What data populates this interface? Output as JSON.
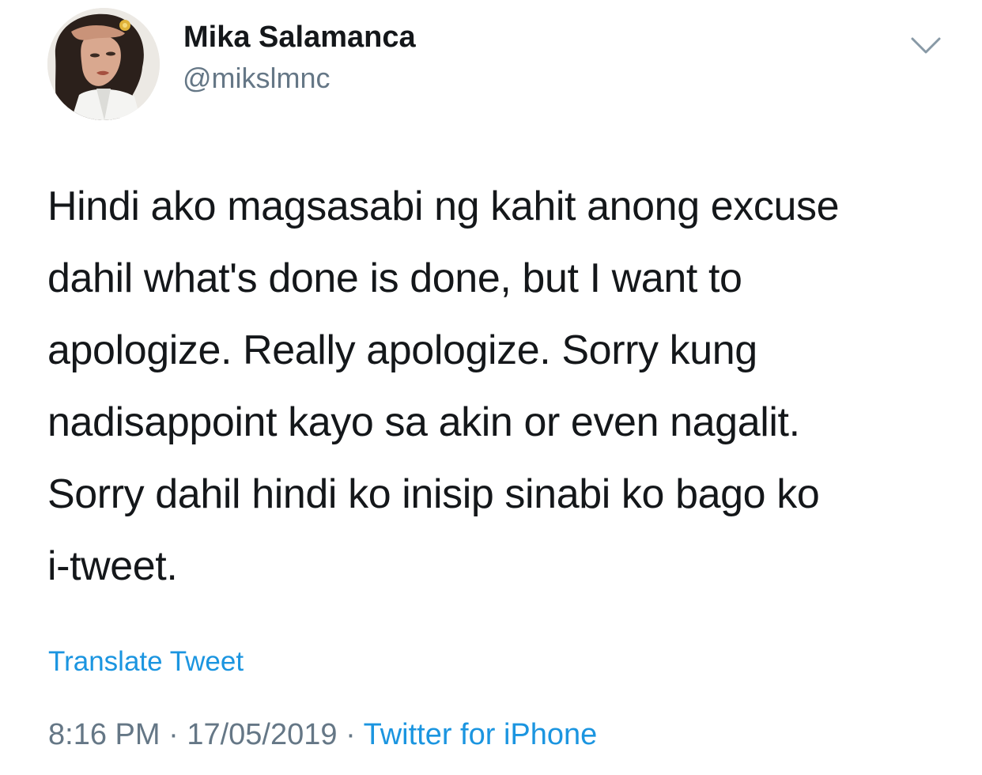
{
  "tweet": {
    "author": {
      "display_name": "Mika Salamanca",
      "handle": "@mikslmnc"
    },
    "text_lines": [
      "Hindi ako magsasabi ng kahit anong excuse",
      "dahil what's done is done, but I want to",
      "apologize. Really apologize. Sorry kung",
      "nadisappoint kayo sa akin or even nagalit.",
      "Sorry dahil hindi ko inisip sinabi ko bago ko",
      "i-tweet."
    ],
    "translate_label": "Translate Tweet",
    "time": "8:16 PM",
    "separator": "·",
    "date": "17/05/2019",
    "source": "Twitter for iPhone"
  },
  "colors": {
    "text": "#14171a",
    "secondary": "#657786",
    "link": "#1b95e0"
  },
  "icons": {
    "menu": "chevron-down-icon",
    "avatar": "profile-photo"
  }
}
